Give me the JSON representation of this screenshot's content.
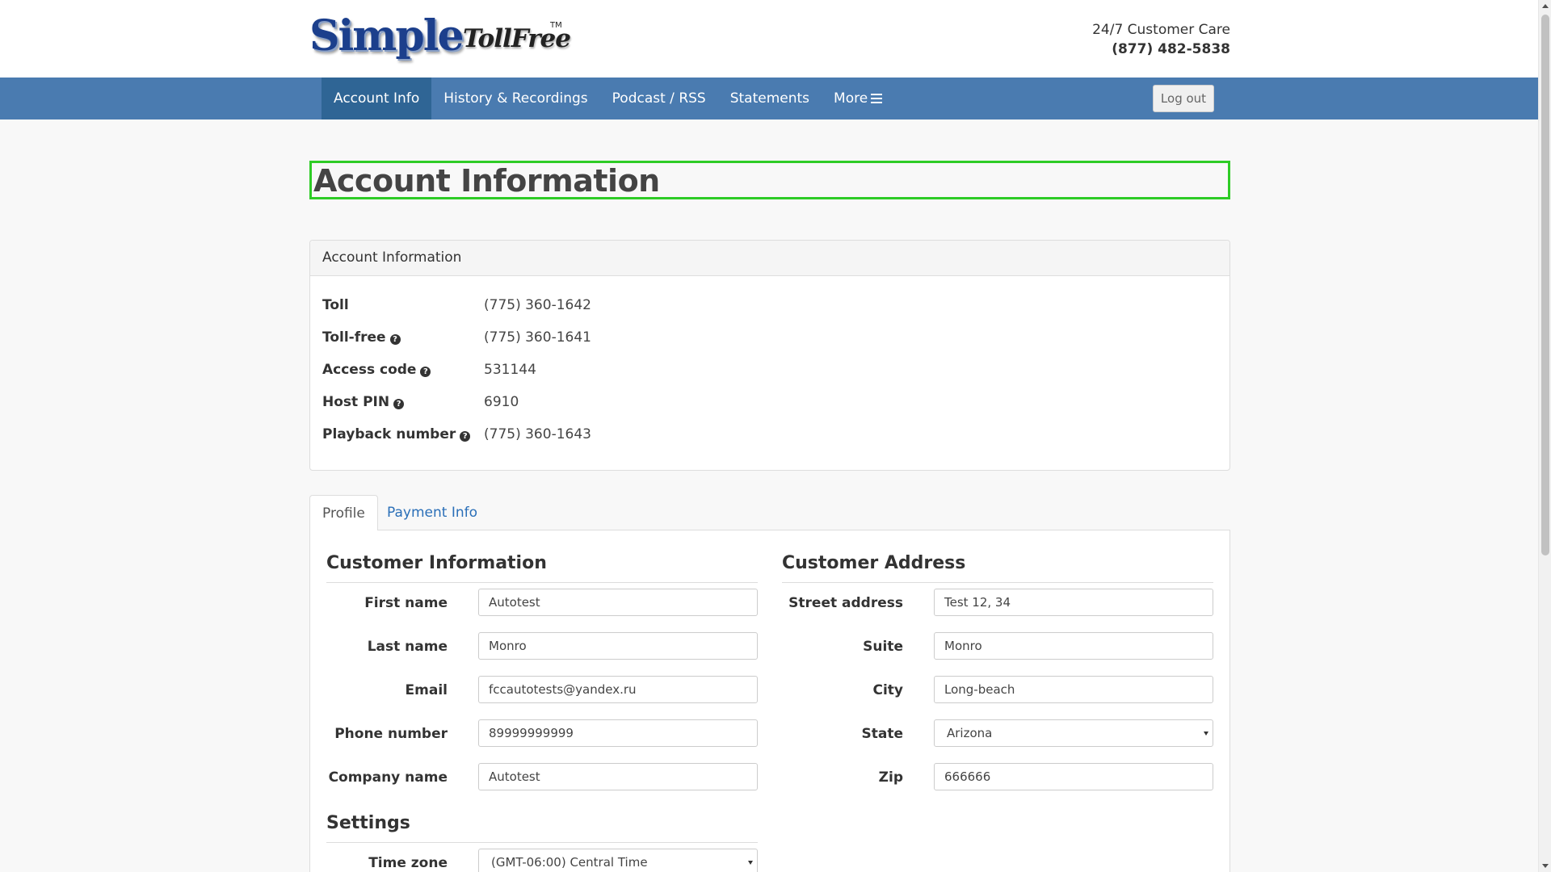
{
  "header": {
    "logo_text_main": "Simple",
    "logo_text_sub": "TollFree",
    "logo_tm": "TM",
    "care_label": "24/7 Customer Care",
    "care_phone": "(877) 482-5838"
  },
  "nav": {
    "items": [
      {
        "label": "Account Info",
        "active": true
      },
      {
        "label": "History & Recordings",
        "active": false
      },
      {
        "label": "Podcast / RSS",
        "active": false
      },
      {
        "label": "Statements",
        "active": false
      },
      {
        "label": "More",
        "active": false,
        "icon": "menu-icon"
      }
    ],
    "logout_label": "Log out"
  },
  "page": {
    "title": "Account Information"
  },
  "account_panel": {
    "heading": "Account Information",
    "rows": [
      {
        "label": "Toll",
        "value": "(775) 360-1642",
        "help": false
      },
      {
        "label": "Toll-free",
        "value": "(775) 360-1641",
        "help": true
      },
      {
        "label": "Access code",
        "value": "531144",
        "help": true
      },
      {
        "label": "Host PIN",
        "value": "6910",
        "help": true
      },
      {
        "label": "Playback number",
        "value": "(775) 360-1643",
        "help": true
      }
    ]
  },
  "tabs": [
    {
      "label": "Profile",
      "active": true
    },
    {
      "label": "Payment Info",
      "active": false
    }
  ],
  "customer_info": {
    "title": "Customer Information",
    "fields": [
      {
        "label": "First name",
        "value": "Autotest"
      },
      {
        "label": "Last name",
        "value": "Monro"
      },
      {
        "label": "Email",
        "value": "fccautotests@yandex.ru"
      },
      {
        "label": "Phone number",
        "value": "89999999999"
      },
      {
        "label": "Company name",
        "value": "Autotest"
      }
    ]
  },
  "customer_address": {
    "title": "Customer Address",
    "fields": [
      {
        "label": "Street address",
        "value": "Test 12, 34"
      },
      {
        "label": "Suite",
        "value": "Monro"
      },
      {
        "label": "City",
        "value": "Long-beach"
      },
      {
        "label": "State",
        "value": "Arizona"
      },
      {
        "label": "Zip",
        "value": "666666"
      }
    ]
  },
  "settings": {
    "title": "Settings",
    "timezone_label": "Time zone",
    "timezone_value": "(GMT-06:00) Central Time"
  },
  "colors": {
    "navbar": "#4a7bb0",
    "nav_active": "#2f6595",
    "link": "#2a6fb8",
    "highlight": "#2ecc26"
  }
}
